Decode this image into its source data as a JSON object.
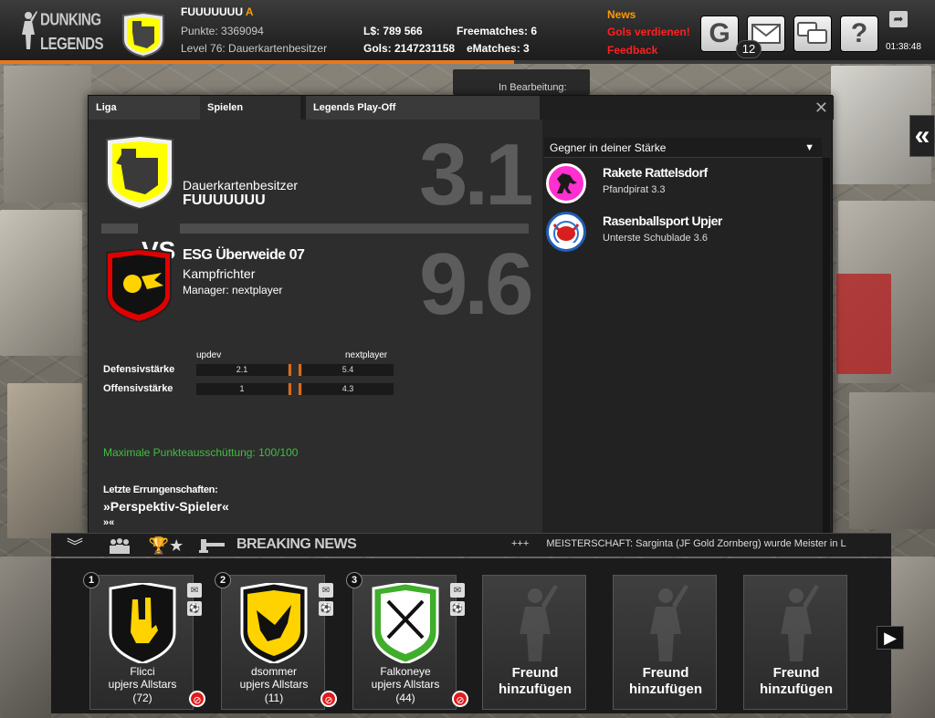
{
  "header": {
    "logo": {
      "line1": "DUNKING",
      "line2": "LEGENDS"
    },
    "username": "FUUUUUUU",
    "user_grade": "A",
    "points": "Punkte: 3369094",
    "level": "Level 76: Dauerkartenbesitzer",
    "ls": "L$: 789 566",
    "gols": "Gols: 2147231158",
    "freematches": "Freematches: 6",
    "ematches": "eMatches: 3",
    "news": "News",
    "gols_verdienen": "Gols verdienen!",
    "feedback": "Feedback",
    "g_button": "G",
    "message_count": "12",
    "help_button": "?",
    "clock": "01:38:48",
    "progress_percent": 55
  },
  "behind_panel": "In Bearbeitung:",
  "dialog": {
    "tabs": [
      "Liga",
      "Spielen",
      "Legends Play-Off"
    ],
    "close": "✕",
    "home": {
      "title": "Dauerkartenbesitzer",
      "name": "FUUUUUUU",
      "score": "3.1"
    },
    "vs": "VS",
    "away": {
      "name": "ESG Überweide 07",
      "title": "Kampfrichter",
      "manager": "Manager: nextplayer",
      "score": "9.6"
    },
    "stats": {
      "left_name": "updev",
      "right_name": "nextplayer",
      "rows": [
        {
          "label": "Defensivstärke",
          "left": "2.1",
          "right": "5.4"
        },
        {
          "label": "Offensivstärke",
          "left": "1",
          "right": "4.3"
        }
      ]
    },
    "payout": "Maximale Punkteausschüttung: 100/100",
    "achievements_title": "Letzte Errungenschaften:",
    "achievement_1": "»Perspektiv-Spieler«",
    "achievement_2": "»«",
    "opponents_title": "Gegner in deiner Stärke",
    "opponents": [
      {
        "name": "Rakete Rattelsdorf",
        "sub": "Pfandpirat 3.3"
      },
      {
        "name": "Rasenballsport Upjer",
        "sub": "Unterste Schublade 3.6"
      }
    ]
  },
  "newsbar": {
    "breaking": "BREAKING NEWS",
    "plus": "+++",
    "ticker": "MEISTERSCHAFT: Sarginta (JF Gold Zornberg) wurde Meister in L"
  },
  "friends": [
    {
      "rank": "1",
      "name": "Flicci",
      "team": "upjers Allstars",
      "level": "(72)"
    },
    {
      "rank": "2",
      "name": "dsommer",
      "team": "upjers Allstars",
      "level": "(11)"
    },
    {
      "rank": "3",
      "name": "Falkoneye",
      "team": "upjers Allstars",
      "level": "(44)"
    }
  ],
  "add_friend": {
    "line1": "Freund",
    "line2": "hinzufügen"
  },
  "colors": {
    "accent": "#e8781a",
    "team_yellow": "#ffff00",
    "team_red": "#e00000",
    "payout_green": "#3fbf3f"
  }
}
